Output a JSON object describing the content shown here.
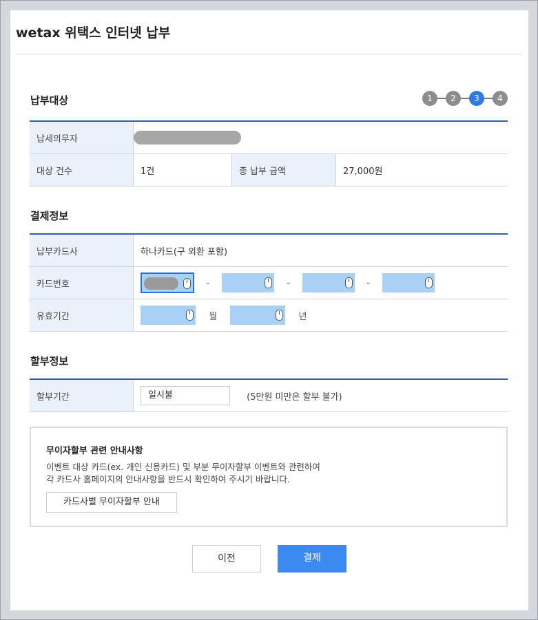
{
  "window_title": "wetax 위택스 인터넷 납부",
  "steps": [
    "1",
    "2",
    "3",
    "4"
  ],
  "active_step": 3,
  "sections": {
    "target": "납부대상",
    "payment_info": "결제정보",
    "installment_info": "할부정보"
  },
  "target": {
    "taxpayer_label": "납세의무자",
    "count_label": "대상 건수",
    "count_value": "1건",
    "total_label": "총 납부 금액",
    "total_value": "27,000원"
  },
  "payment": {
    "card_company_label": "납부카드사",
    "card_company_value": "하나카드(구 외환 포함)",
    "card_number_label": "카드번호",
    "separator": "-",
    "expiry_label": "유효기간",
    "month_unit": "월",
    "year_unit": "년"
  },
  "installment": {
    "period_label": "할부기간",
    "period_value": "일시불",
    "note": "(5만원 미만은 할부 불가)"
  },
  "notice": {
    "title": "무이자할부 관련 안내사항",
    "line1": "이벤트 대상 카드(ex. 개인 신용카드) 및 부분 무이자할부 이벤트와 관련하여",
    "line2": "각 카드사 홈페이지의 안내사항을 반드시 확인하여 주시기 바랍니다.",
    "button": "카드사별 무이자할부 안내"
  },
  "buttons": {
    "prev": "이전",
    "pay": "결제"
  },
  "colors": {
    "accent": "#3b8af2",
    "input_fill": "#a9d0f5",
    "header_cell": "#ebf1fb"
  }
}
